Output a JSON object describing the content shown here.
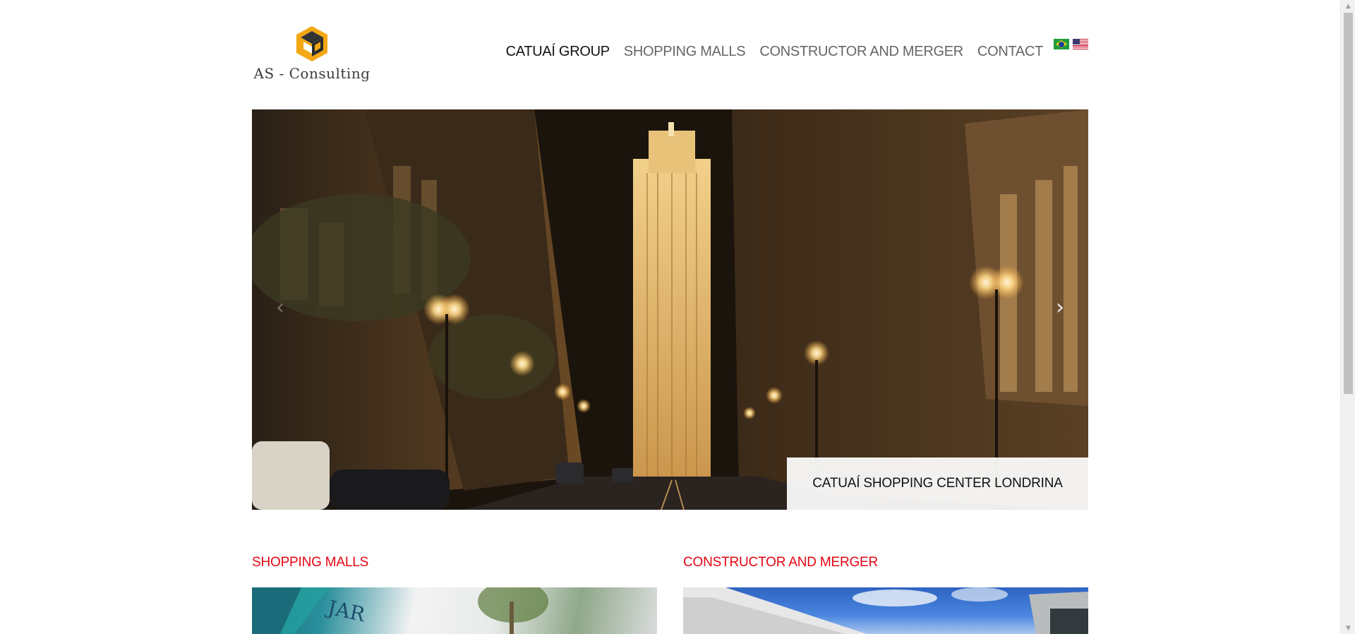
{
  "logo": {
    "text": "AS - Consulting",
    "icon": "hexagon-logo-icon"
  },
  "nav": {
    "items": [
      {
        "label": "CATUAÍ GROUP",
        "active": true
      },
      {
        "label": "SHOPPING MALLS",
        "active": false
      },
      {
        "label": "CONSTRUCTOR AND MERGER",
        "active": false
      },
      {
        "label": "CONTACT",
        "active": false
      }
    ],
    "languages": [
      "brazil-flag-icon",
      "usa-flag-icon"
    ]
  },
  "slider": {
    "caption": "CATUAÍ SHOPPING CENTER LONDRINA",
    "prev_icon": "chevron-left-icon",
    "next_icon": "chevron-right-icon",
    "prev_glyph": "‹",
    "next_glyph": "›"
  },
  "sections": [
    {
      "title": "SHOPPING MALLS"
    },
    {
      "title": "CONSTRUCTOR AND MERGER"
    }
  ],
  "colors": {
    "section_title": "#e30613",
    "nav_active": "#111111",
    "nav_inactive": "#666666",
    "logo_accent": "#f3a712"
  }
}
